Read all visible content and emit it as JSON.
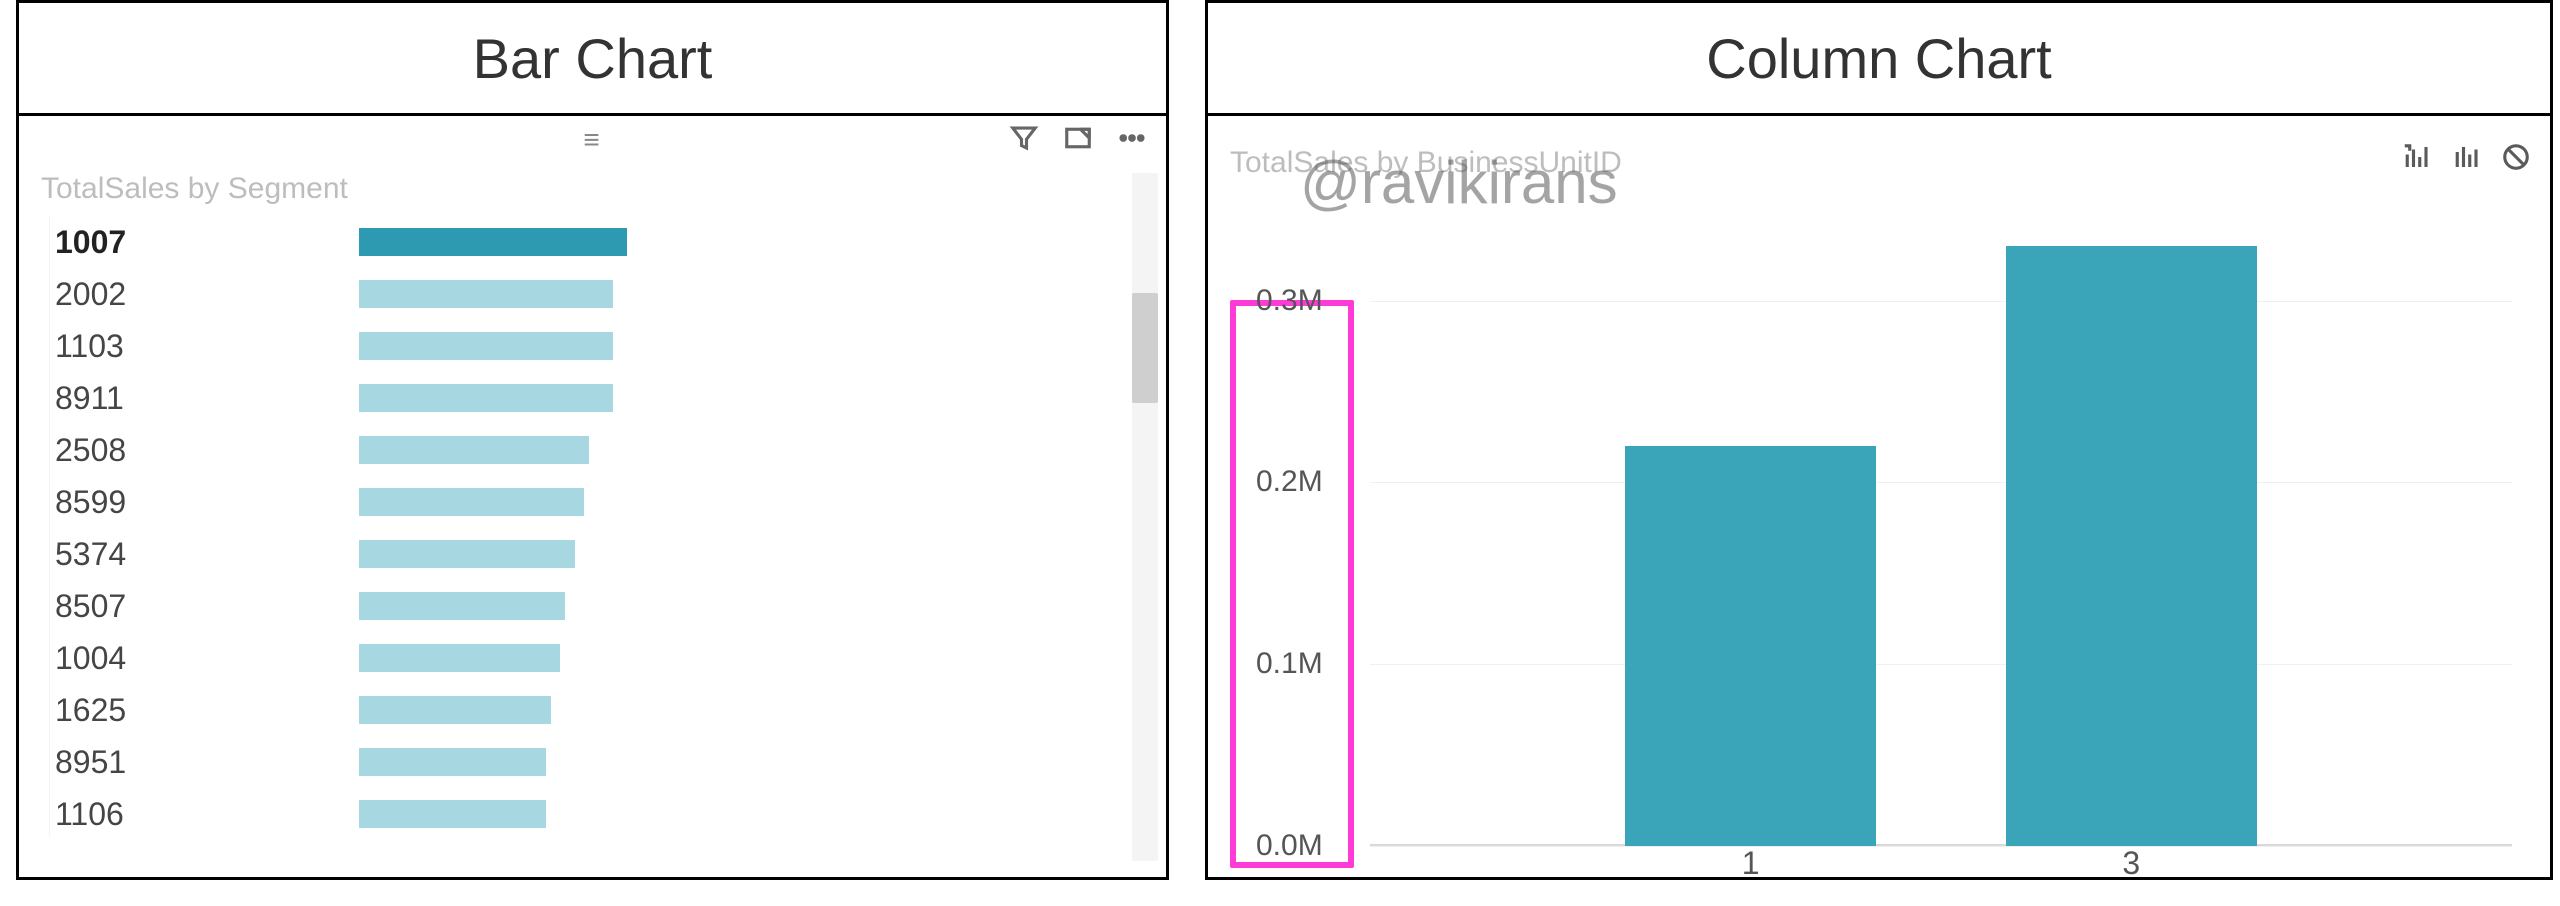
{
  "watermark": "@ravikirans",
  "left": {
    "title": "Bar Chart",
    "subtitle": "TotalSales by Segment",
    "selected_index": 0
  },
  "right": {
    "title": "Column Chart",
    "subtitle": "TotalSales by BusinessUnitID"
  },
  "chart_data": [
    {
      "type": "bar",
      "title": "TotalSales by Segment",
      "orientation": "horizontal",
      "xlabel": "TotalSales",
      "ylabel": "Segment",
      "categories": [
        "1007",
        "2002",
        "1103",
        "8911",
        "2508",
        "8599",
        "5374",
        "8507",
        "1004",
        "1625",
        "8951",
        "1106"
      ],
      "values": [
        280,
        265,
        265,
        265,
        240,
        235,
        225,
        215,
        210,
        200,
        195,
        195
      ],
      "xlim": [
        0,
        800
      ],
      "note": "values are approximate (arbitrary units); only bar lengths visible, no x-axis tick labels shown"
    },
    {
      "type": "bar",
      "title": "TotalSales by BusinessUnitID",
      "orientation": "vertical",
      "xlabel": "BusinessUnitID",
      "ylabel": "TotalSales",
      "categories": [
        "1",
        "3"
      ],
      "values": [
        220000,
        330000
      ],
      "ylim": [
        0,
        330000
      ],
      "yticks": [
        "0.0M",
        "0.1M",
        "0.2M",
        "0.3M"
      ],
      "ytick_values": [
        0,
        100000,
        200000,
        300000
      ]
    }
  ]
}
